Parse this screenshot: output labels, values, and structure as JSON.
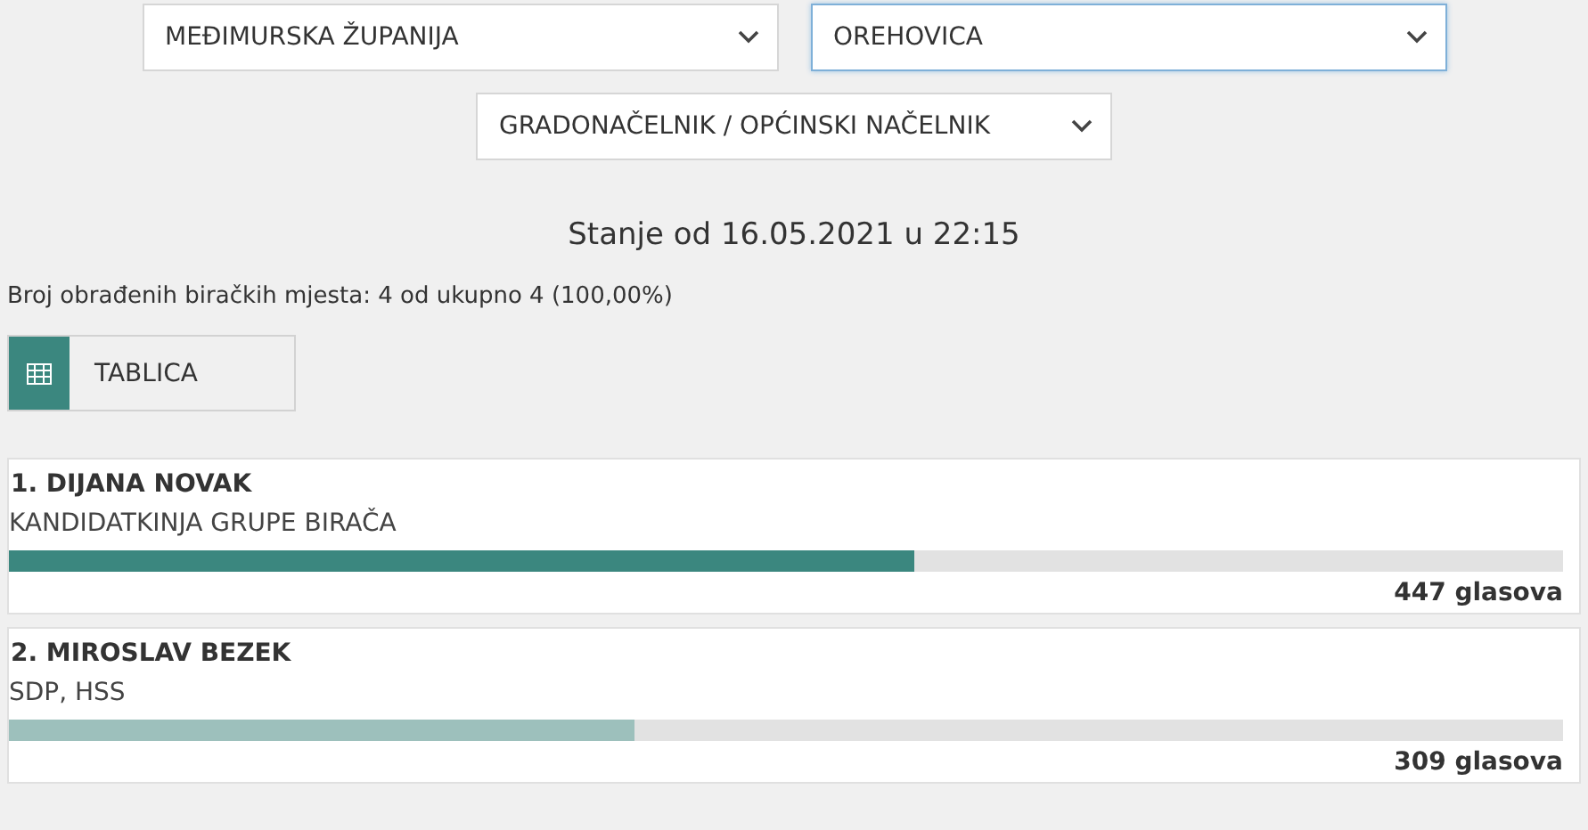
{
  "filters": [
    {
      "value": "MEĐIMURSKA ŽUPANIJA",
      "focused": false
    },
    {
      "value": "OREHOVICA",
      "focused": true
    }
  ],
  "election_type": {
    "value": "GRADONAČELNIK / OPĆINSKI NAČELNIK",
    "focused": false
  },
  "status_title": "Stanje od 16.05.2021 u 22:15",
  "processed_info": "Broj obrađenih biračkih mjesta: 4 od ukupno 4 (100,00%)",
  "table_button": "TABLICA",
  "candidates": [
    {
      "name": "1. DIJANA NOVAK",
      "party": "KANDIDATKINJA GRUPE BIRAČA",
      "level": 0.583,
      "color": "#3b877f",
      "votes": "447 glasova"
    },
    {
      "name": "2. MIROSLAV BEZEK",
      "party": "SDP, HSS",
      "level": 0.403,
      "color": "#9dc0bc",
      "votes": "309 glasova"
    }
  ]
}
